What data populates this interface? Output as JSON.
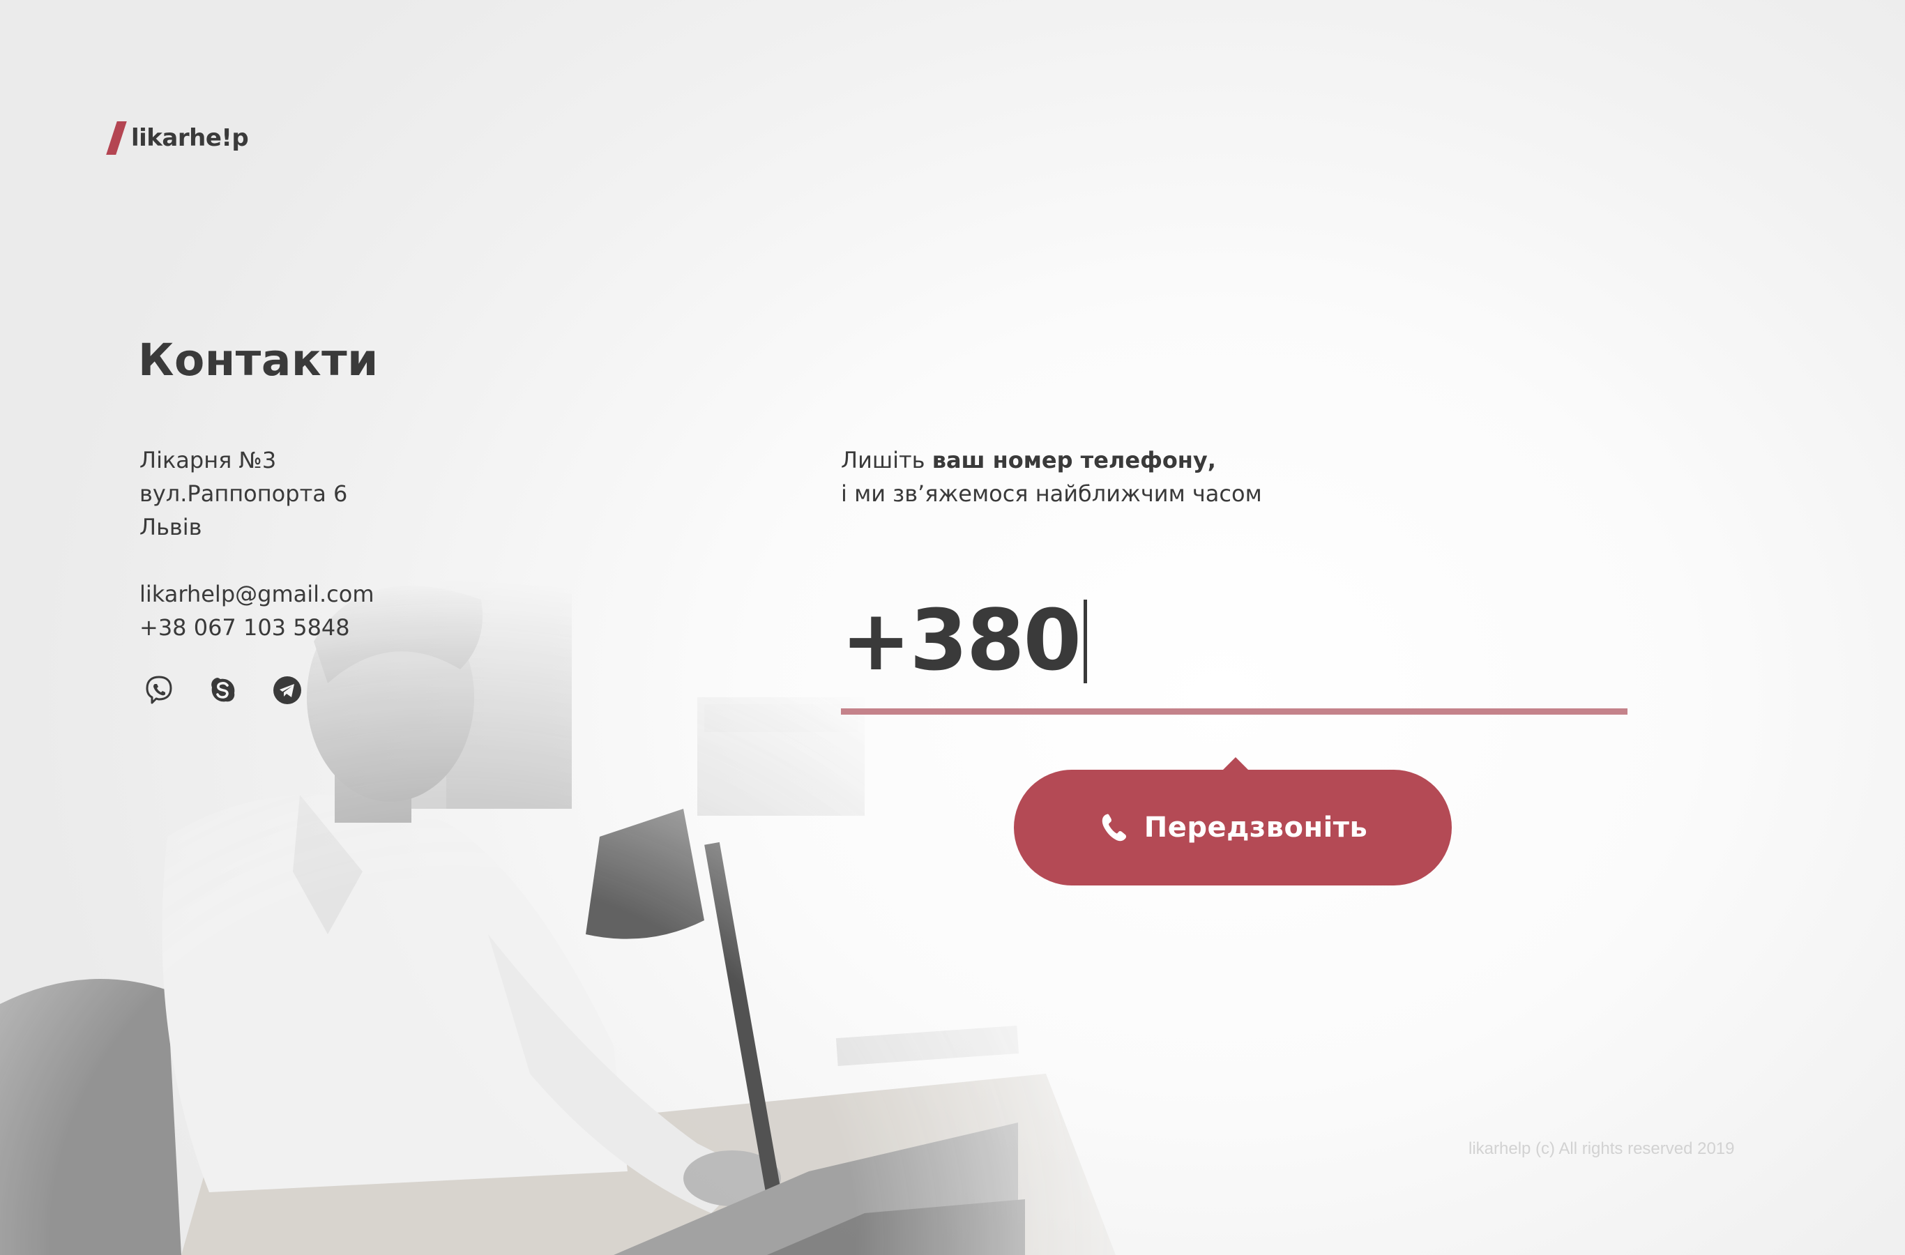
{
  "logo": {
    "text": "likarhe!p"
  },
  "contacts": {
    "title": "Контакти",
    "address": [
      "Лікарня №3",
      "вул.Раппопорта 6",
      "Львів"
    ],
    "email": "likarhelp@gmail.com",
    "phone": "+38 067 103 5848",
    "socials": [
      {
        "name": "viber",
        "icon": "viber-icon"
      },
      {
        "name": "skype",
        "icon": "skype-icon"
      },
      {
        "name": "telegram",
        "icon": "telegram-icon"
      }
    ]
  },
  "form": {
    "prompt_plain_1": "Лишіть ",
    "prompt_bold": "ваш номер телефону,",
    "prompt_line_2": "і ми зв’яжемося найближчим часом",
    "phone_prefix": "+380",
    "phone_value": "",
    "button_label": "Передзвоніть",
    "button_icon": "phone-icon"
  },
  "footer": {
    "copyright": "likarhelp (c) All rights reserved 2019"
  },
  "colors": {
    "accent": "#b44a55",
    "underline": "#c4828a",
    "text": "#3a3a3a"
  }
}
